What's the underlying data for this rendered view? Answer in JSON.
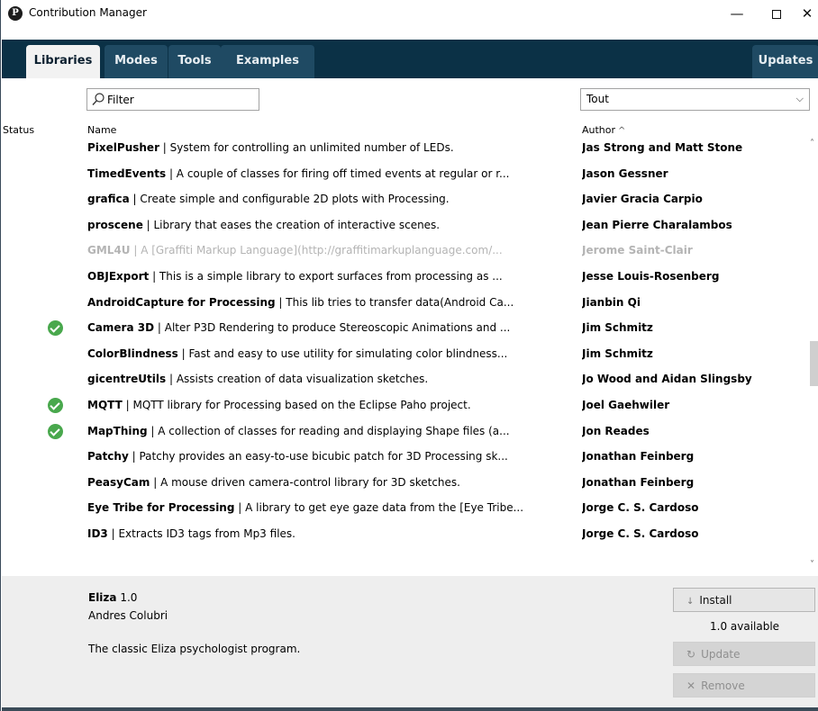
{
  "window": {
    "title": "Contribution Manager",
    "minimize_glyph": "—",
    "close_glyph": "✕"
  },
  "tabs": [
    {
      "label": "Libraries",
      "selected": true
    },
    {
      "label": "Modes",
      "selected": false
    },
    {
      "label": "Tools",
      "selected": false
    },
    {
      "label": "Examples",
      "selected": false
    },
    {
      "label": "Updates",
      "selected": false
    }
  ],
  "filter": {
    "placeholder": "Filter",
    "value": ""
  },
  "category": {
    "selected": "Tout"
  },
  "columns": {
    "status": "Status",
    "name": "Name",
    "author": "Author",
    "author_sort": "^"
  },
  "libraries": [
    {
      "name": "PixelPusher",
      "desc": " | System for controlling an unlimited number of LEDs.",
      "author": "Jas Strong and Matt Stone",
      "installed": false,
      "disabled": false
    },
    {
      "name": "TimedEvents",
      "desc": " | A couple of classes for firing off timed events at regular or r...",
      "author": "Jason Gessner",
      "installed": false,
      "disabled": false
    },
    {
      "name": "grafica",
      "desc": " | Create simple and configurable 2D plots with Processing.",
      "author": "Javier Gracia Carpio",
      "installed": false,
      "disabled": false
    },
    {
      "name": "proscene",
      "desc": " | Library that eases the creation of interactive scenes.",
      "author": "Jean Pierre Charalambos",
      "installed": false,
      "disabled": false
    },
    {
      "name": "GML4U",
      "desc": " | A [Graffiti Markup Language](http://graffitimarkuplanguage.com/...",
      "author": "Jerome Saint-Clair",
      "installed": false,
      "disabled": true
    },
    {
      "name": "OBJExport",
      "desc": " | This is a simple library to export surfaces from processing as ...",
      "author": "Jesse Louis-Rosenberg",
      "installed": false,
      "disabled": false
    },
    {
      "name": "AndroidCapture for Processing",
      "desc": " | This lib tries to transfer data(Android Ca...",
      "author": "Jianbin Qi",
      "installed": false,
      "disabled": false
    },
    {
      "name": "Camera 3D",
      "desc": " | Alter P3D Rendering to produce Stereoscopic Animations and ...",
      "author": "Jim Schmitz",
      "installed": true,
      "disabled": false
    },
    {
      "name": "ColorBlindness",
      "desc": " | Fast and easy to use utility for simulating color blindness...",
      "author": "Jim Schmitz",
      "installed": false,
      "disabled": false
    },
    {
      "name": "gicentreUtils",
      "desc": " | Assists creation of data visualization sketches.",
      "author": "Jo Wood and Aidan Slingsby",
      "installed": false,
      "disabled": false
    },
    {
      "name": "MQTT",
      "desc": " | MQTT library for Processing based on the Eclipse Paho project.",
      "author": "Joel Gaehwiler",
      "installed": true,
      "disabled": false
    },
    {
      "name": "MapThing",
      "desc": " | A collection of classes for reading and displaying Shape files (a...",
      "author": "Jon Reades",
      "installed": true,
      "disabled": false
    },
    {
      "name": "Patchy",
      "desc": " | Patchy provides an easy-to-use bicubic patch for 3D Processing sk...",
      "author": "Jonathan Feinberg",
      "installed": false,
      "disabled": false
    },
    {
      "name": "PeasyCam",
      "desc": " | A mouse driven camera-control library for 3D sketches.",
      "author": "Jonathan Feinberg",
      "installed": false,
      "disabled": false
    },
    {
      "name": "Eye Tribe for Processing",
      "desc": " | A library to get eye gaze data from the [Eye Tribe...",
      "author": "Jorge C. S. Cardoso",
      "installed": false,
      "disabled": false
    },
    {
      "name": "ID3",
      "desc": " | Extracts ID3 tags from Mp3 files.",
      "author": "Jorge C. S. Cardoso",
      "installed": false,
      "disabled": false
    }
  ],
  "detail": {
    "name": "Eliza",
    "version": " 1.0",
    "author": "Andres Colubri",
    "description": "The classic Eliza psychologist program.",
    "install_label": "Install",
    "available_label": "1.0 available",
    "update_label": "Update",
    "remove_label": "Remove"
  },
  "colors": {
    "tab_bar": "#0b3146",
    "tab_inactive": "#1f4a63",
    "installed_check": "#49a84d",
    "detail_panel": "#eeeeee",
    "disabled_text": "#b4b4b4"
  }
}
